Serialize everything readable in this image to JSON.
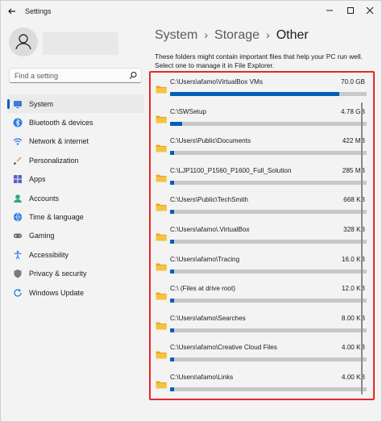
{
  "app": {
    "title": "Settings"
  },
  "search": {
    "placeholder": "Find a setting"
  },
  "breadcrumb": {
    "part1": "System",
    "part2": "Storage",
    "current": "Other",
    "separator": "›"
  },
  "description": "These folders might contain important files that help your PC run well. Select one to manage it in File Explorer.",
  "colors": {
    "accent": "#005fb8",
    "highlight_border": "#e5272d",
    "folder": "#f5c242"
  },
  "nav": [
    {
      "label": "System",
      "icon": "system-icon",
      "active": true
    },
    {
      "label": "Bluetooth & devices",
      "icon": "bluetooth-icon"
    },
    {
      "label": "Network & internet",
      "icon": "wifi-icon"
    },
    {
      "label": "Personalization",
      "icon": "brush-icon"
    },
    {
      "label": "Apps",
      "icon": "apps-icon"
    },
    {
      "label": "Accounts",
      "icon": "account-icon"
    },
    {
      "label": "Time & language",
      "icon": "globe-icon"
    },
    {
      "label": "Gaming",
      "icon": "gamepad-icon"
    },
    {
      "label": "Accessibility",
      "icon": "accessibility-icon"
    },
    {
      "label": "Privacy & security",
      "icon": "shield-icon"
    },
    {
      "label": "Windows Update",
      "icon": "update-icon"
    }
  ],
  "folders": [
    {
      "path": "C:\\Users\\afamo\\VirtualBox VMs",
      "size": "70.0 GB",
      "fill": 0.86
    },
    {
      "path": "C:\\SWSetup",
      "size": "4.78 GB",
      "fill": 0.06
    },
    {
      "path": "C:\\Users\\Public\\Documents",
      "size": "422 MB",
      "fill": 0.01
    },
    {
      "path": "C:\\LJP1100_P1560_P1600_Full_Solution",
      "size": "285 MB",
      "fill": 0.01
    },
    {
      "path": "C:\\Users\\Public\\TechSmith",
      "size": "668 KB",
      "fill": 0.005
    },
    {
      "path": "C:\\Users\\afamo\\.VirtualBox",
      "size": "328 KB",
      "fill": 0.005
    },
    {
      "path": "C:\\Users\\afamo\\Tracing",
      "size": "16.0 KB",
      "fill": 0.005
    },
    {
      "path": "C:\\ (Files at drive root)",
      "size": "12.0 KB",
      "fill": 0.005
    },
    {
      "path": "C:\\Users\\afamo\\Searches",
      "size": "8.00 KB",
      "fill": 0.005
    },
    {
      "path": "C:\\Users\\afamo\\Creative Cloud Files",
      "size": "4.00 KB",
      "fill": 0.005
    },
    {
      "path": "C:\\Users\\afamo\\Links",
      "size": "4.00 KB",
      "fill": 0.005
    }
  ]
}
